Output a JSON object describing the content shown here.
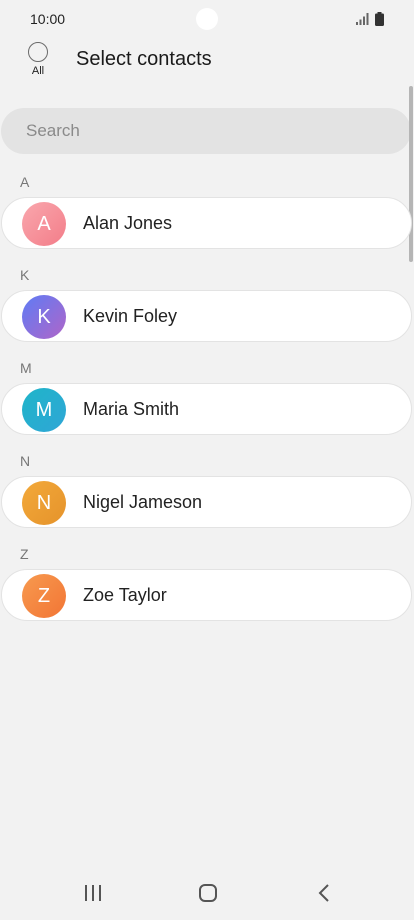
{
  "status_bar": {
    "time": "10:00",
    "icons": [
      "signal-icon",
      "battery-icon"
    ]
  },
  "header": {
    "select_all_label": "All",
    "title": "Select contacts"
  },
  "search": {
    "placeholder": "Search"
  },
  "sections": [
    {
      "letter": "A",
      "contact": {
        "initial": "A",
        "name": "Alan Jones",
        "avatar_colors": [
          "#f9a7ad",
          "#f37d89"
        ]
      }
    },
    {
      "letter": "K",
      "contact": {
        "initial": "K",
        "name": "Kevin Foley",
        "avatar_colors": [
          "#5e7cf5",
          "#b065c8"
        ]
      }
    },
    {
      "letter": "M",
      "contact": {
        "initial": "M",
        "name": "Maria Smith",
        "avatar_colors": [
          "#1fb5c9",
          "#2fa6d6"
        ]
      }
    },
    {
      "letter": "N",
      "contact": {
        "initial": "N",
        "name": "Nigel Jameson",
        "avatar_colors": [
          "#f3a93a",
          "#e5932b"
        ]
      }
    },
    {
      "letter": "Z",
      "contact": {
        "initial": "Z",
        "name": "Zoe Taylor",
        "avatar_colors": [
          "#f79a4f",
          "#f27535"
        ]
      }
    }
  ],
  "nav_bar": {
    "icons": [
      "recent-apps-icon",
      "home-icon",
      "back-icon"
    ]
  }
}
